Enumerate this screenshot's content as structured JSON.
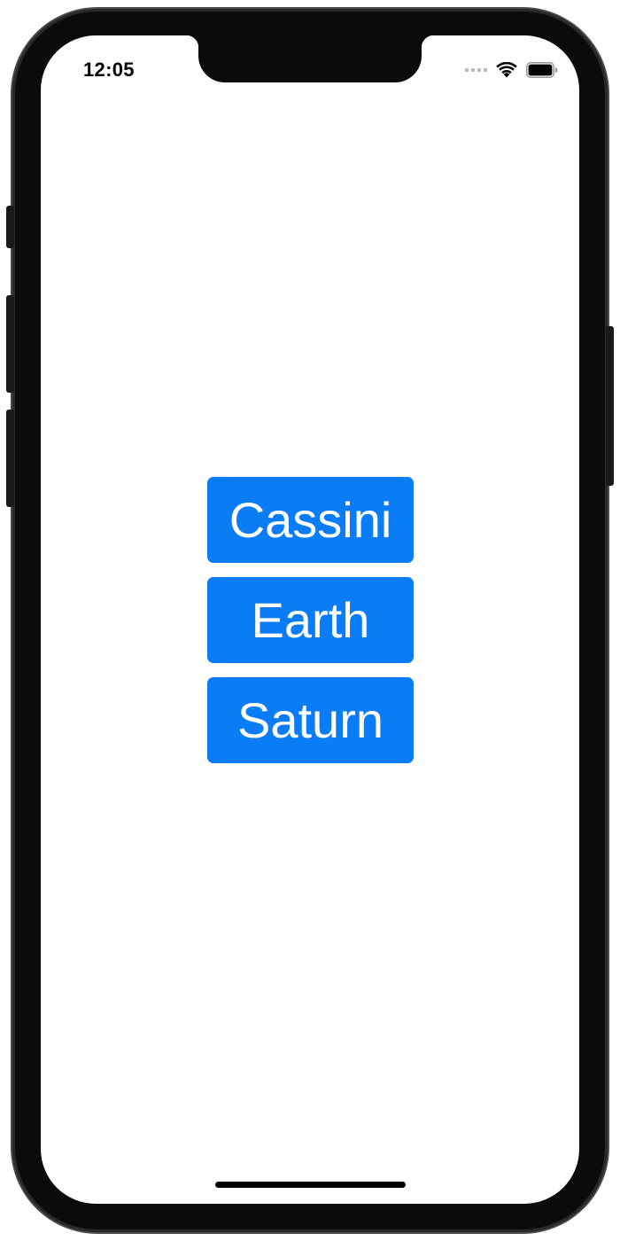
{
  "status_bar": {
    "time": "12:05",
    "wifi_icon": "wifi-icon",
    "battery_icon": "battery-icon",
    "signal_icon": "cellular-signal-icon"
  },
  "main": {
    "buttons": [
      {
        "label": "Cassini"
      },
      {
        "label": "Earth"
      },
      {
        "label": "Saturn"
      }
    ]
  },
  "colors": {
    "button_background": "#0A7CF6",
    "button_text": "#FFFFFF",
    "screen_background": "#FFFFFF",
    "frame": "#0B0B0B"
  }
}
